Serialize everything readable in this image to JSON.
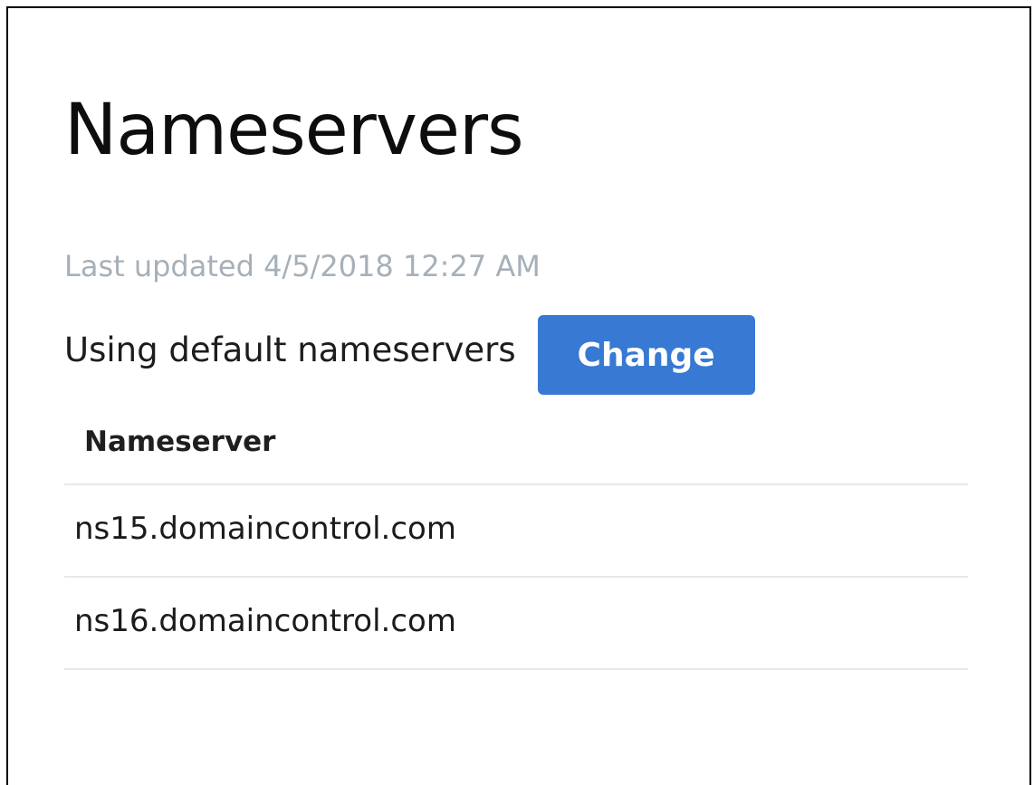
{
  "page": {
    "title": "Nameservers",
    "last_updated": "Last updated 4/5/2018 12:27 AM",
    "status_text": "Using default nameservers",
    "change_label": "Change"
  },
  "table": {
    "header": "Nameserver",
    "rows": [
      "ns15.domaincontrol.com",
      "ns16.domaincontrol.com"
    ]
  },
  "colors": {
    "accent": "#3779d3",
    "muted_text": "#a7b0b8",
    "divider": "#e8e8e8"
  }
}
